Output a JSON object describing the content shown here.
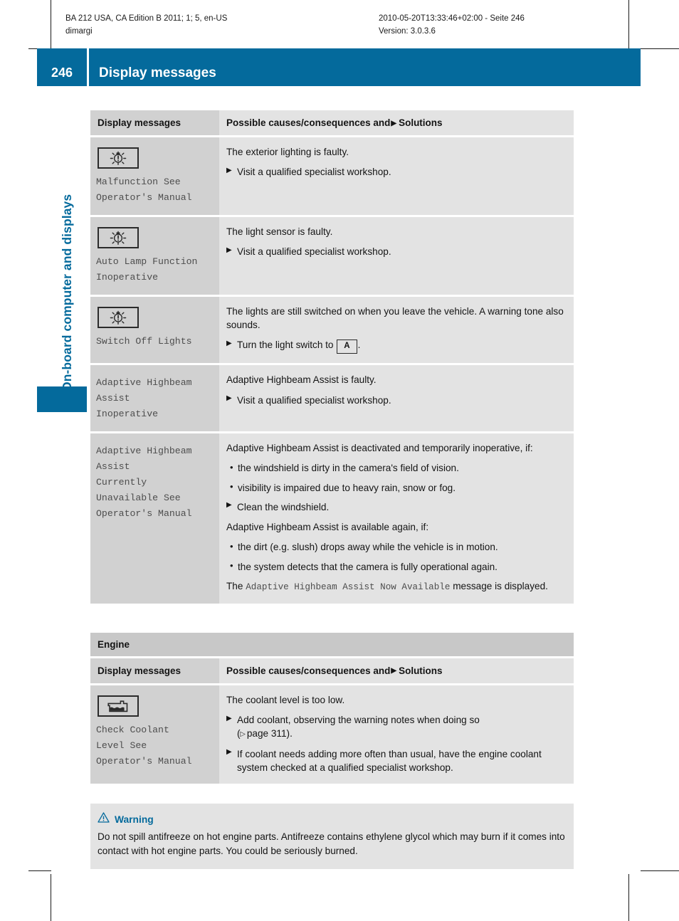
{
  "running_head": {
    "left_line1": "BA 212 USA, CA Edition B 2011; 1; 5, en-US",
    "left_line2": "dimargi",
    "right_line1": "2010-05-20T13:33:46+02:00 - Seite 246",
    "right_line2": "Version: 3.0.3.6"
  },
  "banner": {
    "page_number": "246",
    "title": "Display messages"
  },
  "chapter_label": "On-board computer and displays",
  "accent_color": "#046a9c",
  "table1": {
    "headers": {
      "col1": "Display messages",
      "col2_pre": "Possible causes/consequences and",
      "col2_post": "Solutions"
    },
    "rows": [
      {
        "icon": "lamp-malfunction-icon",
        "message": "Malfunction See\nOperator's Manual",
        "cause": "The exterior lighting is faulty.",
        "steps": [
          "Visit a qualified specialist workshop."
        ]
      },
      {
        "icon": "lamp-malfunction-icon",
        "message": "Auto Lamp Function\nInoperative",
        "cause": "The light sensor is faulty.",
        "steps": [
          "Visit a qualified specialist workshop."
        ]
      },
      {
        "icon": "lamp-malfunction-icon",
        "message": "Switch Off Lights",
        "cause": "The lights are still switched on when you leave the vehicle. A warning tone also sounds.",
        "step_prefix": "Turn the light switch to",
        "step_key": "A",
        "step_suffix": "."
      },
      {
        "icon": null,
        "message": "Adaptive Highbeam\nAssist\nInoperative",
        "cause": "Adaptive Highbeam Assist is faulty.",
        "steps": [
          "Visit a qualified specialist workshop."
        ]
      },
      {
        "icon": null,
        "message": "Adaptive Highbeam\nAssist\nCurrently\nUnavailable See\nOperator's Manual",
        "cause": "Adaptive Highbeam Assist is deactivated and temporarily inoperative, if:",
        "bullets1": [
          "the windshield is dirty in the camera's field of vision.",
          "visibility is impaired due to heavy rain, snow or fog."
        ],
        "step2": "Clean the windshield.",
        "cause2": "Adaptive Highbeam Assist is available again, if:",
        "bullets2": [
          "the dirt (e.g. slush) drops away while the vehicle is in motion.",
          "the system detects that the camera is fully operational again."
        ],
        "final_pre": "The",
        "final_msg": "Adaptive Highbeam Assist Now Available",
        "final_post": "message is displayed."
      }
    ]
  },
  "section_engine": "Engine",
  "table2": {
    "headers": {
      "col1": "Display messages",
      "col2_pre": "Possible causes/consequences and",
      "col2_post": "Solutions"
    },
    "row": {
      "icon": "coolant-level-icon",
      "message": "Check Coolant\nLevel See\nOperator's Manual",
      "cause": "The coolant level is too low.",
      "step1_line1": "Add coolant, observing the warning notes when doing so",
      "step1_ref_open": "(",
      "step1_ref_text": "page 311",
      "step1_ref_close": ").",
      "step2": "If coolant needs adding more often than usual, have the engine coolant system checked at a qualified specialist workshop."
    }
  },
  "warning": {
    "icon": "warning-triangle-icon",
    "title": "Warning",
    "body": "Do not spill antifreeze on hot engine parts. Antifreeze contains ethylene glycol which may burn if it comes into contact with hot engine parts. You could be seriously burned."
  }
}
